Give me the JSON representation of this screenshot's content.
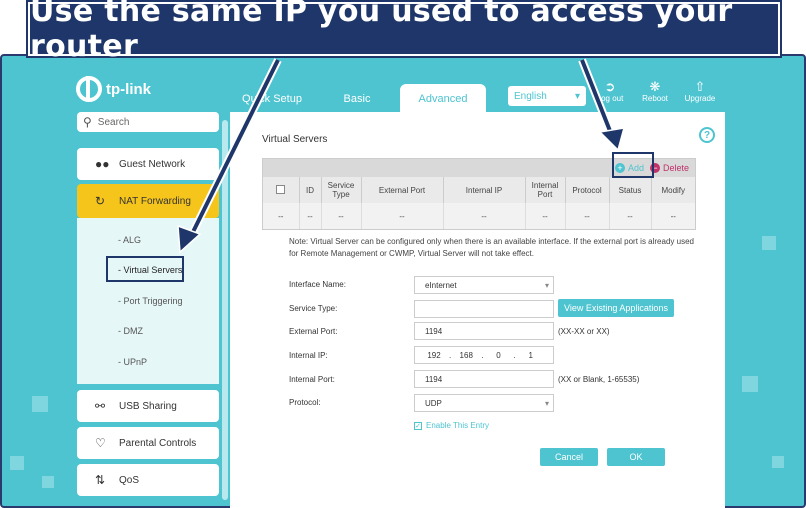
{
  "banner": {
    "text": "Use the same IP you used to access your router"
  },
  "brand": {
    "logo_text": "tp-link"
  },
  "colors": {
    "accent": "#4dc4d0",
    "active_item": "#f6c51b",
    "banner_bg": "#1e3669",
    "delete": "#c0306a"
  },
  "top_nav": {
    "tabs": [
      {
        "label": "Quick Setup"
      },
      {
        "label": "Basic"
      },
      {
        "label": "Advanced",
        "active": true
      }
    ],
    "language": "English",
    "tools": [
      {
        "label": "Log out",
        "icon": "logout-icon"
      },
      {
        "label": "Reboot",
        "icon": "reboot-icon"
      },
      {
        "label": "Upgrade",
        "icon": "upgrade-icon"
      }
    ]
  },
  "sidebar": {
    "search_placeholder": "Search",
    "items": [
      {
        "label": "Guest Network",
        "icon": "guest-network-icon"
      },
      {
        "label": "NAT Forwarding",
        "icon": "nat-forwarding-icon",
        "active": true
      },
      {
        "label": "USB Sharing",
        "icon": "usb-icon"
      },
      {
        "label": "Parental Controls",
        "icon": "parental-controls-icon"
      },
      {
        "label": "QoS",
        "icon": "qos-icon"
      }
    ],
    "sub_items": [
      {
        "label": "- ALG"
      },
      {
        "label": "- Virtual Servers",
        "active": true
      },
      {
        "label": "- Port Triggering"
      },
      {
        "label": "- DMZ"
      },
      {
        "label": "- UPnP"
      }
    ]
  },
  "main": {
    "section_title": "Virtual Servers",
    "help_icon": "?",
    "toolbar": {
      "add_label": "Add",
      "delete_label": "Delete"
    },
    "table": {
      "headers": [
        "",
        "ID",
        "Service Type",
        "External Port",
        "Internal IP",
        "Internal Port",
        "Protocol",
        "Status",
        "Modify"
      ],
      "rows": [
        [
          "--",
          "--",
          "--",
          "--",
          "--",
          "--",
          "--",
          "--",
          "--"
        ]
      ]
    },
    "note": "Note: Virtual Server can be configured only when there is an available interface. If the external port is already used for Remote Management or CWMP, Virtual Server will not take effect.",
    "form": {
      "interface_name": {
        "label": "Interface Name:",
        "value": "eInternet"
      },
      "service_type": {
        "label": "Service Type:",
        "value": "",
        "button": "View Existing Applications"
      },
      "external_port": {
        "label": "External Port:",
        "value": "1194",
        "hint": "(XX-XX or XX)"
      },
      "internal_ip": {
        "label": "Internal IP:",
        "octets": [
          "192",
          "168",
          "0",
          "1"
        ]
      },
      "internal_port": {
        "label": "Internal Port:",
        "value": "1194",
        "hint": "(XX or Blank, 1-65535)"
      },
      "protocol": {
        "label": "Protocol:",
        "value": "UDP"
      },
      "enable_entry": {
        "label": "Enable This Entry",
        "checked": true
      }
    },
    "buttons": {
      "cancel": "Cancel",
      "ok": "OK"
    }
  }
}
